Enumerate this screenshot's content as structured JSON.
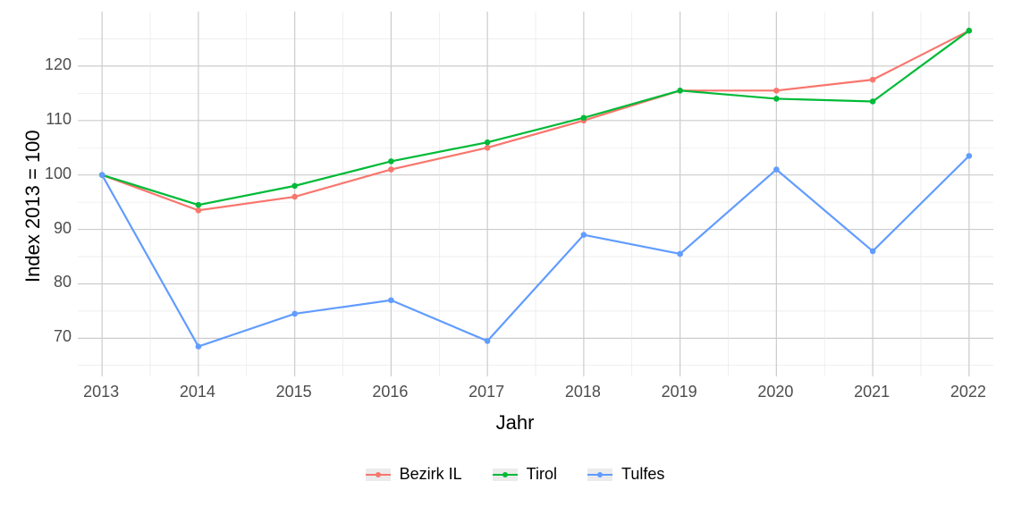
{
  "chart_data": {
    "type": "line",
    "xlabel": "Jahr",
    "ylabel": "Index  2013  =  100",
    "categories": [
      2013,
      2014,
      2015,
      2016,
      2017,
      2018,
      2019,
      2020,
      2021,
      2022
    ],
    "x_ticks": [
      "2013",
      "2014",
      "2015",
      "2016",
      "2017",
      "2018",
      "2019",
      "2020",
      "2021",
      "2022"
    ],
    "y_ticks": [
      70,
      80,
      90,
      100,
      110,
      120
    ],
    "ylim": [
      63,
      130
    ],
    "grid": true,
    "legend_position": "bottom",
    "series": [
      {
        "name": "Bezirk IL",
        "color": "#f8766d",
        "values": [
          100,
          93.5,
          96,
          101,
          105,
          110,
          115.5,
          115.5,
          117.5,
          126.5
        ]
      },
      {
        "name": "Tirol",
        "color": "#00ba38",
        "values": [
          100,
          94.5,
          98,
          102.5,
          106,
          110.5,
          115.5,
          114,
          113.5,
          126.5
        ]
      },
      {
        "name": "Tulfes",
        "color": "#619cff",
        "values": [
          100,
          68.5,
          74.5,
          77,
          69.5,
          89,
          85.5,
          101,
          86,
          103.5
        ]
      }
    ]
  }
}
